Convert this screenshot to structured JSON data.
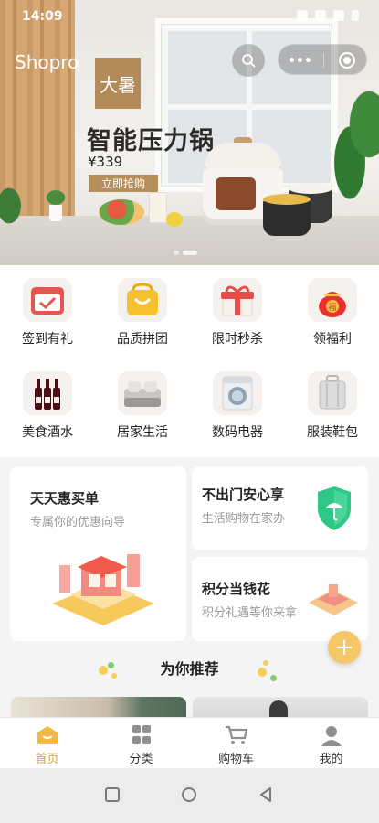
{
  "status_bar": {
    "time": "14:09"
  },
  "header": {
    "app_title": "Shopro"
  },
  "banner": {
    "logo_text": "大暑",
    "title": "智能压力锅",
    "price": "¥339",
    "cta": "立即抢购",
    "active_slide": 2,
    "slide_count": 2
  },
  "categories": [
    {
      "label": "签到有礼",
      "icon": "calendar-check-icon"
    },
    {
      "label": "品质拼团",
      "icon": "shopping-bag-icon"
    },
    {
      "label": "限时秒杀",
      "icon": "gift-box-icon"
    },
    {
      "label": "领福利",
      "icon": "lucky-bag-icon"
    },
    {
      "label": "美食酒水",
      "icon": "wine-bottles-icon"
    },
    {
      "label": "居家生活",
      "icon": "bedding-icon"
    },
    {
      "label": "数码电器",
      "icon": "washing-machine-icon"
    },
    {
      "label": "服装鞋包",
      "icon": "suitcase-icon"
    }
  ],
  "promos": {
    "daily": {
      "title": "天天惠买单",
      "subtitle": "专属你的优惠向导"
    },
    "home": {
      "title": "不出门安心享",
      "subtitle": "生活购物在家办"
    },
    "points": {
      "title": "积分当钱花",
      "subtitle": "积分礼遇等你来拿"
    }
  },
  "recommend": {
    "title": "为你推荐"
  },
  "fab": {
    "label": "+"
  },
  "tabbar": {
    "items": [
      {
        "label": "首页",
        "icon": "home-icon",
        "active": true
      },
      {
        "label": "分类",
        "icon": "category-grid-icon",
        "active": false
      },
      {
        "label": "购物车",
        "icon": "cart-icon",
        "active": false
      },
      {
        "label": "我的",
        "icon": "profile-icon",
        "active": false
      }
    ]
  },
  "colors": {
    "accent": "#d6a23d",
    "banner_cta": "#b48e5c",
    "fab": "#f5c766"
  }
}
